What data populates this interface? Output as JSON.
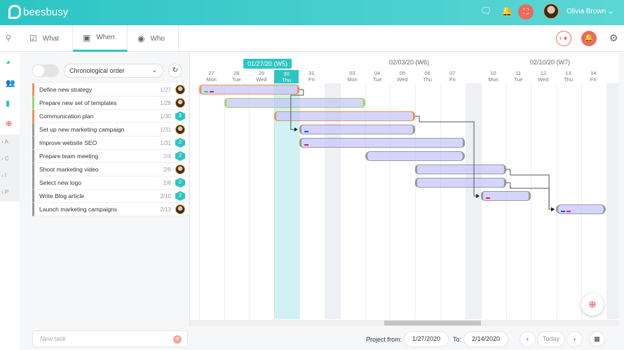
{
  "header": {
    "brand": "beesbusy",
    "user_name": "Olivia Brown",
    "icons": [
      "help-chat-icon",
      "bell-icon",
      "fullscreen-icon",
      "chevron-down-icon"
    ]
  },
  "tabs": [
    {
      "label": "What",
      "icon": "clipboard-check-icon"
    },
    {
      "label": "When",
      "icon": "calendar-icon",
      "active": true
    },
    {
      "label": "Who",
      "icon": "user-circle-icon"
    }
  ],
  "toolbar": {
    "sort_select": "Chronological order"
  },
  "sidebar": {
    "icons": [
      "search-icon",
      "pie-chart-icon",
      "team-icon",
      "document-icon",
      "add-icon"
    ],
    "folders": [
      "A",
      "C",
      "I",
      "P"
    ]
  },
  "tasks": [
    {
      "name": "Define new strategy",
      "date": "1/27",
      "date_highlight": true,
      "assignee": "avatar",
      "color": "#f39055",
      "start": "01/27",
      "end": "01/30",
      "tags": [
        "#2ecc9a",
        "#e8185a"
      ]
    },
    {
      "name": "Prepare new set of templates",
      "date": "1/28",
      "assignee": "avatar",
      "color": "#9ed36a",
      "start": "01/28",
      "end": "02/03",
      "tags": []
    },
    {
      "name": "Communication plan",
      "date": "1/30",
      "assignee": "3",
      "color": "#f39055",
      "start": "01/30",
      "end": "02/05",
      "tags": []
    },
    {
      "name": "Set up new marketing campaign",
      "date": "1/31",
      "assignee": "avatar",
      "color": "#999999",
      "start": "01/31",
      "end": "02/05",
      "tags": [
        "#1a4fff"
      ]
    },
    {
      "name": "Improve website SEO",
      "date": "1/31",
      "assignee": "2",
      "color": "#999999",
      "start": "01/31",
      "end": "02/07",
      "tags": [
        "#e8185a"
      ]
    },
    {
      "name": "Prepare team meeting",
      "date": "2/4",
      "date_highlight": true,
      "assignee": "2",
      "color": "#999999",
      "start": "02/04",
      "end": "02/07",
      "tags": [],
      "milestone": true
    },
    {
      "name": "Shoot marketing video",
      "date": "2/6",
      "assignee": "avatar",
      "color": "#999999",
      "start": "02/06",
      "end": "02/10",
      "tags": []
    },
    {
      "name": "Select new logo",
      "date": "2/6",
      "assignee": "2",
      "color": "#999999",
      "start": "02/06",
      "end": "02/10",
      "tags": []
    },
    {
      "name": "Write Blog article",
      "date": "2/10",
      "assignee": "2",
      "color": "#999999",
      "start": "02/10",
      "end": "02/11",
      "tags": [
        "#e8185a"
      ]
    },
    {
      "name": "Launch marketing campaigns",
      "date": "2/13",
      "assignee": "avatar",
      "color": "#999999",
      "start": "02/13",
      "end": "02/14",
      "tags": [
        "#1a4fff",
        "#c21aff"
      ],
      "milestone": true
    }
  ],
  "dependencies": [
    [
      0,
      3
    ],
    [
      2,
      8
    ],
    [
      6,
      9
    ],
    [
      7,
      9
    ]
  ],
  "timeline": {
    "weeks": [
      {
        "label": "01/27/20 (W5)",
        "current": true,
        "days": [
          {
            "d": "27",
            "w": "Mon",
            "k": "01/27"
          },
          {
            "d": "28",
            "w": "Tue",
            "k": "01/28"
          },
          {
            "d": "29",
            "w": "Wed",
            "k": "01/29"
          },
          {
            "d": "30",
            "w": "Thu",
            "k": "01/30",
            "today": true
          },
          {
            "d": "31",
            "w": "Fri",
            "k": "01/31"
          }
        ]
      },
      {
        "label": "02/03/20 (W6)",
        "days": [
          {
            "d": "03",
            "w": "Mon",
            "k": "02/03"
          },
          {
            "d": "04",
            "w": "Tue",
            "k": "02/04"
          },
          {
            "d": "05",
            "w": "Wed",
            "k": "02/05"
          },
          {
            "d": "06",
            "w": "Thu",
            "k": "02/06"
          },
          {
            "d": "07",
            "w": "Fri",
            "k": "02/07"
          }
        ]
      },
      {
        "label": "02/10/20 (W7)",
        "days": [
          {
            "d": "10",
            "w": "Mon",
            "k": "02/10"
          },
          {
            "d": "11",
            "w": "Tue",
            "k": "02/11"
          },
          {
            "d": "12",
            "w": "Wed",
            "k": "02/12"
          },
          {
            "d": "13",
            "w": "Thu",
            "k": "02/13"
          },
          {
            "d": "14",
            "w": "Fri",
            "k": "02/14"
          }
        ]
      }
    ]
  },
  "footer": {
    "new_task_placeholder": "New task",
    "project_from_label": "Project from:",
    "project_from": "1/27/2020",
    "to_label": "To:",
    "project_to": "2/14/2020",
    "today_label": "Today",
    "prev": "‹",
    "next": "›"
  }
}
